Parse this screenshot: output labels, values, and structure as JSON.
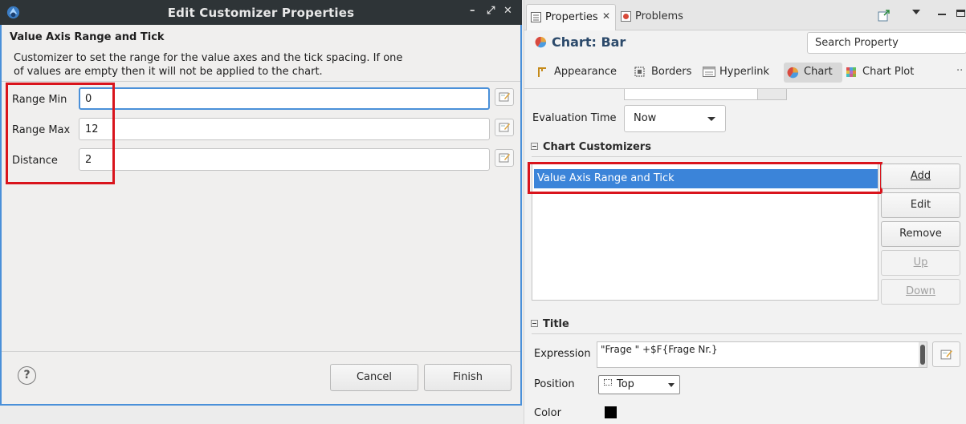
{
  "dialog": {
    "title": "Edit Customizer Properties",
    "window_buttons": [
      "–",
      "⤢",
      "✕"
    ],
    "heading": "Value Axis Range and Tick",
    "description": "Customizer to set the range for the value axes and the tick spacing. If one\nof values are empty then it will not be applied to the chart.",
    "fields": [
      {
        "label": "Range Min",
        "value": "0"
      },
      {
        "label": "Range Max",
        "value": "12"
      },
      {
        "label": "Distance",
        "value": "2"
      }
    ],
    "help": "?",
    "cancel_label": "Cancel",
    "finish_label": "Finish"
  },
  "views": {
    "properties_tab": "Properties",
    "problems_tab": "Problems"
  },
  "properties": {
    "title": "Chart: Bar",
    "search_placeholder": "Search Property",
    "tabs": [
      "Appearance",
      "Borders",
      "Hyperlink",
      "Chart",
      "Chart Plot"
    ],
    "tabs_more": "··",
    "active_tab": "Chart",
    "evaluation_time_label": "Evaluation Time",
    "evaluation_time_value": "Now",
    "chart_customizers_heading": "Chart Customizers",
    "customizers": [
      "Value Axis Range and Tick"
    ],
    "buttons": {
      "add": "Add",
      "edit": "Edit",
      "remove": "Remove",
      "up": "Up",
      "down": "Down"
    },
    "title_section": "Title",
    "expression_label": "Expression",
    "expression_value": "\"Frage \" +$F{Frage Nr.}",
    "position_label": "Position",
    "position_value": "Top",
    "color_label": "Color",
    "color_value": "#000000"
  },
  "colors": {
    "selection": "#3b84d9",
    "highlight_box": "#d9141c",
    "focus": "#4a90d9"
  }
}
